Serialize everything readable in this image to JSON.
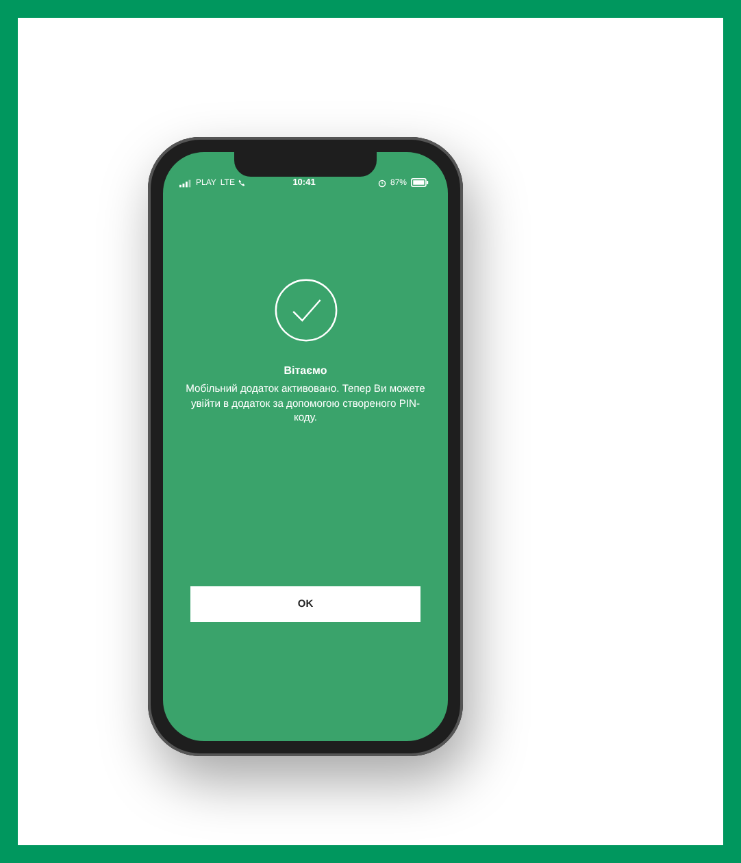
{
  "status_bar": {
    "carrier": "PLAY",
    "network": "LTE",
    "time": "10:41",
    "battery": "87%"
  },
  "title": "Вітаємо",
  "message": "Мобільний додаток активовано. Тепер Ви можете увійти в додаток за допомогою створеного PIN-коду.",
  "button": "OK"
}
